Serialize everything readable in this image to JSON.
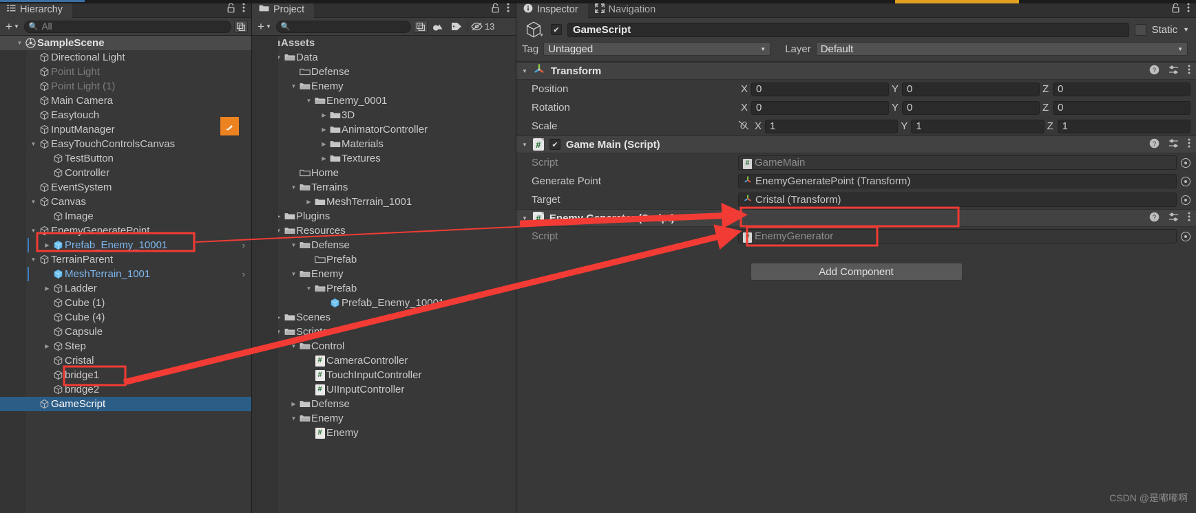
{
  "hierarchy": {
    "tab_label": "Hierarchy",
    "tab_icon": "hierarchy-icon",
    "add_label": "+",
    "search_placeholder": "All",
    "items": [
      {
        "label": "SampleScene",
        "depth": 0,
        "arrow": "down",
        "style": "scene",
        "icon": "unity-scene-icon"
      },
      {
        "label": "Directional Light",
        "depth": 1,
        "arrow": "none",
        "style": "normal",
        "icon": "gameobject-icon"
      },
      {
        "label": "Point Light",
        "depth": 1,
        "arrow": "none",
        "style": "dim",
        "icon": "gameobject-icon"
      },
      {
        "label": "Point Light (1)",
        "depth": 1,
        "arrow": "none",
        "style": "dim",
        "icon": "gameobject-icon"
      },
      {
        "label": "Main Camera",
        "depth": 1,
        "arrow": "none",
        "style": "normal",
        "icon": "gameobject-icon"
      },
      {
        "label": "Easytouch",
        "depth": 1,
        "arrow": "none",
        "style": "normal",
        "icon": "gameobject-icon"
      },
      {
        "label": "InputManager",
        "depth": 1,
        "arrow": "none",
        "style": "normal",
        "icon": "gameobject-icon"
      },
      {
        "label": "EasyTouchControlsCanvas",
        "depth": 1,
        "arrow": "down",
        "style": "normal",
        "icon": "gameobject-icon"
      },
      {
        "label": "TestButton",
        "depth": 2,
        "arrow": "none",
        "style": "normal",
        "icon": "gameobject-icon"
      },
      {
        "label": "Controller",
        "depth": 2,
        "arrow": "none",
        "style": "normal",
        "icon": "gameobject-icon"
      },
      {
        "label": "EventSystem",
        "depth": 1,
        "arrow": "none",
        "style": "normal",
        "icon": "gameobject-icon"
      },
      {
        "label": "Canvas",
        "depth": 1,
        "arrow": "down",
        "style": "normal",
        "icon": "gameobject-icon"
      },
      {
        "label": "Image",
        "depth": 2,
        "arrow": "none",
        "style": "normal",
        "icon": "gameobject-icon"
      },
      {
        "label": "EnemyGeneratePoint",
        "depth": 1,
        "arrow": "down",
        "style": "normal",
        "icon": "gameobject-icon"
      },
      {
        "label": "Prefab_Enemy_10001",
        "depth": 2,
        "arrow": "right",
        "style": "prefab",
        "icon": "prefab-icon",
        "more": "›"
      },
      {
        "label": "TerrainParent",
        "depth": 1,
        "arrow": "down",
        "style": "normal",
        "icon": "gameobject-icon"
      },
      {
        "label": "MeshTerrain_1001",
        "depth": 2,
        "arrow": "none",
        "style": "prefab",
        "icon": "prefab-icon",
        "more": "›"
      },
      {
        "label": "Ladder",
        "depth": 2,
        "arrow": "right",
        "style": "normal",
        "icon": "gameobject-icon"
      },
      {
        "label": "Cube (1)",
        "depth": 2,
        "arrow": "none",
        "style": "normal",
        "icon": "gameobject-icon"
      },
      {
        "label": "Cube (4)",
        "depth": 2,
        "arrow": "none",
        "style": "normal",
        "icon": "gameobject-icon"
      },
      {
        "label": "Capsule",
        "depth": 2,
        "arrow": "none",
        "style": "normal",
        "icon": "gameobject-icon"
      },
      {
        "label": "Step",
        "depth": 2,
        "arrow": "right",
        "style": "normal",
        "icon": "gameobject-icon"
      },
      {
        "label": "Cristal",
        "depth": 2,
        "arrow": "none",
        "style": "normal",
        "icon": "gameobject-icon"
      },
      {
        "label": "bridge1",
        "depth": 2,
        "arrow": "none",
        "style": "normal",
        "icon": "gameobject-icon"
      },
      {
        "label": "bridge2",
        "depth": 2,
        "arrow": "none",
        "style": "normal",
        "icon": "gameobject-icon"
      },
      {
        "label": "GameScript",
        "depth": 1,
        "arrow": "none",
        "style": "selected",
        "icon": "gameobject-icon"
      }
    ]
  },
  "project": {
    "tab_label": "Project",
    "add_label": "+",
    "search_placeholder": "",
    "hidden_count": "13",
    "items": [
      {
        "label": "Assets",
        "depth": 0,
        "arrow": "down",
        "icon": "folder-open-icon",
        "bold": true
      },
      {
        "label": "Data",
        "depth": 1,
        "arrow": "down",
        "icon": "folder-open-icon"
      },
      {
        "label": "Defense",
        "depth": 2,
        "arrow": "none",
        "icon": "folder-empty-icon"
      },
      {
        "label": "Enemy",
        "depth": 2,
        "arrow": "down",
        "icon": "folder-open-icon"
      },
      {
        "label": "Enemy_0001",
        "depth": 3,
        "arrow": "down",
        "icon": "folder-open-icon"
      },
      {
        "label": "3D",
        "depth": 4,
        "arrow": "right",
        "icon": "folder-icon"
      },
      {
        "label": "AnimatorController",
        "depth": 4,
        "arrow": "right",
        "icon": "folder-icon"
      },
      {
        "label": "Materials",
        "depth": 4,
        "arrow": "right",
        "icon": "folder-icon"
      },
      {
        "label": "Textures",
        "depth": 4,
        "arrow": "right",
        "icon": "folder-icon"
      },
      {
        "label": "Home",
        "depth": 2,
        "arrow": "none",
        "icon": "folder-empty-icon"
      },
      {
        "label": "Terrains",
        "depth": 2,
        "arrow": "down",
        "icon": "folder-open-icon"
      },
      {
        "label": "MeshTerrain_1001",
        "depth": 3,
        "arrow": "right",
        "icon": "folder-icon"
      },
      {
        "label": "Plugins",
        "depth": 1,
        "arrow": "right",
        "icon": "folder-icon"
      },
      {
        "label": "Resources",
        "depth": 1,
        "arrow": "down",
        "icon": "folder-open-icon"
      },
      {
        "label": "Defense",
        "depth": 2,
        "arrow": "down",
        "icon": "folder-open-icon"
      },
      {
        "label": "Prefab",
        "depth": 3,
        "arrow": "none",
        "icon": "folder-empty-icon"
      },
      {
        "label": "Enemy",
        "depth": 2,
        "arrow": "down",
        "icon": "folder-open-icon"
      },
      {
        "label": "Prefab",
        "depth": 3,
        "arrow": "down",
        "icon": "folder-open-icon"
      },
      {
        "label": "Prefab_Enemy_10001",
        "depth": 4,
        "arrow": "none",
        "icon": "prefab-icon"
      },
      {
        "label": "Scenes",
        "depth": 1,
        "arrow": "right",
        "icon": "folder-icon"
      },
      {
        "label": "Scripts",
        "depth": 1,
        "arrow": "down",
        "icon": "folder-open-icon"
      },
      {
        "label": "Control",
        "depth": 2,
        "arrow": "down",
        "icon": "folder-open-icon"
      },
      {
        "label": "CameraController",
        "depth": 3,
        "arrow": "none",
        "icon": "csharp-script-icon"
      },
      {
        "label": "TouchInputController",
        "depth": 3,
        "arrow": "none",
        "icon": "csharp-script-icon"
      },
      {
        "label": "UIInputController",
        "depth": 3,
        "arrow": "none",
        "icon": "csharp-script-icon"
      },
      {
        "label": "Defense",
        "depth": 2,
        "arrow": "right",
        "icon": "folder-icon"
      },
      {
        "label": "Enemy",
        "depth": 2,
        "arrow": "down",
        "icon": "folder-open-icon"
      },
      {
        "label": "Enemy",
        "depth": 3,
        "arrow": "none",
        "icon": "csharp-script-icon"
      }
    ]
  },
  "inspector": {
    "tabs": [
      {
        "label": "Inspector",
        "icon": "info-icon",
        "active": true
      },
      {
        "label": "Navigation",
        "icon": "navigation-icon",
        "active": false
      }
    ],
    "object_name": "GameScript",
    "enabled": true,
    "static_label": "Static",
    "tag_label": "Tag",
    "tag_value": "Untagged",
    "layer_label": "Layer",
    "layer_value": "Default",
    "components": [
      {
        "name": "Transform",
        "icon": "transform-icon",
        "has_checkbox": false,
        "rows": [
          {
            "label": "Position",
            "type": "vector3",
            "x": "0",
            "y": "0",
            "z": "0"
          },
          {
            "label": "Rotation",
            "type": "vector3",
            "x": "0",
            "y": "0",
            "z": "0"
          },
          {
            "label": "Scale",
            "type": "vector3",
            "x": "1",
            "y": "1",
            "z": "1",
            "link_icon": "constrain-proportions-off-icon"
          }
        ]
      },
      {
        "name": "Game Main (Script)",
        "icon": "csharp-script-icon",
        "has_checkbox": true,
        "enabled": true,
        "rows": [
          {
            "label": "Script",
            "type": "object",
            "value": "GameMain",
            "value_icon": "csharp-script-icon",
            "readonly": true
          },
          {
            "label": "Generate Point",
            "type": "object",
            "value": "EnemyGeneratePoint (Transform)",
            "value_icon": "transform-icon",
            "highlighted": true
          },
          {
            "label": "Target",
            "type": "object",
            "value": "Cristal (Transform)",
            "value_icon": "transform-icon",
            "highlighted": true
          }
        ]
      },
      {
        "name": "Enemy Generator (Script)",
        "icon": "csharp-script-icon",
        "has_checkbox": false,
        "rows": [
          {
            "label": "Script",
            "type": "object",
            "value": "EnemyGenerator",
            "value_icon": "csharp-script-icon",
            "readonly": true
          }
        ]
      }
    ],
    "add_component_label": "Add Component"
  },
  "watermark": "CSDN @是嘟嘟啊",
  "colors": {
    "annotation": "#f23b34",
    "selection": "#2c5d87",
    "prefab_blue": "#7eb8ef",
    "panel_bg": "#383838",
    "header_bg": "#424242"
  }
}
